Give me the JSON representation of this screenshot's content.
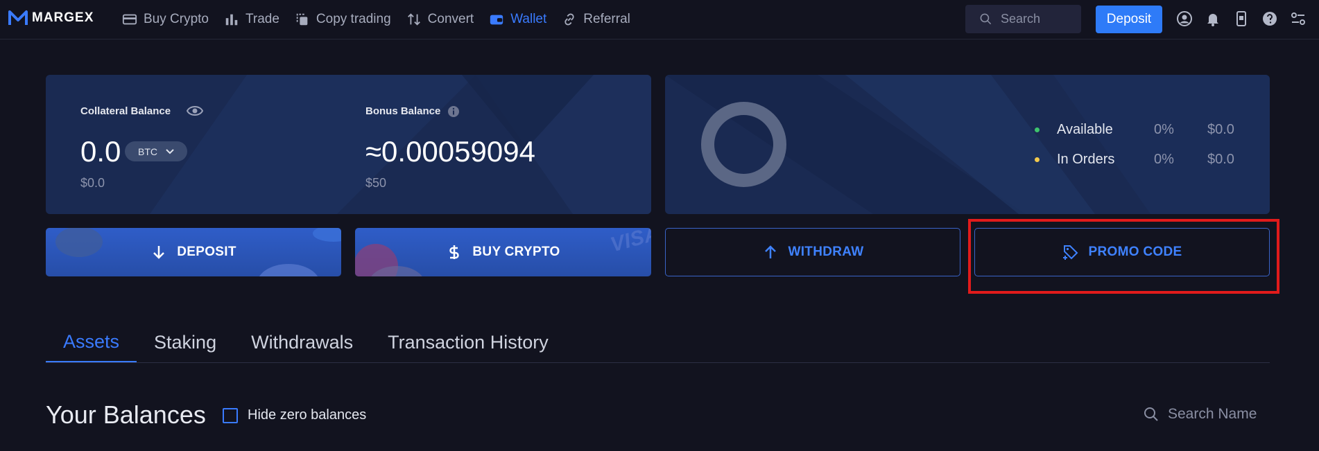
{
  "brand": {
    "name": "MARGEX"
  },
  "nav": {
    "items": [
      {
        "label": "Buy Crypto",
        "icon": "card-icon"
      },
      {
        "label": "Trade",
        "icon": "bar-chart-icon"
      },
      {
        "label": "Copy trading",
        "icon": "copy-icon"
      },
      {
        "label": "Convert",
        "icon": "swap-icon"
      },
      {
        "label": "Wallet",
        "icon": "wallet-icon",
        "active": true
      },
      {
        "label": "Referral",
        "icon": "link-icon"
      }
    ],
    "search_placeholder": "Search",
    "deposit_label": "Deposit",
    "icons": [
      "user-icon",
      "bell-icon",
      "mobile-icon",
      "help-icon",
      "settings-icon"
    ]
  },
  "balances": {
    "collateral": {
      "label": "Collateral Balance",
      "value": "0.0",
      "currency": "BTC",
      "usd": "$0.0"
    },
    "bonus": {
      "label": "Bonus Balance",
      "value": "≈0.00059094",
      "usd": "$50"
    }
  },
  "allocation": {
    "rows": [
      {
        "label": "Available",
        "percent": "0%",
        "amount": "$0.0",
        "color": "#3ec46d"
      },
      {
        "label": "In Orders",
        "percent": "0%",
        "amount": "$0.0",
        "color": "#f2c94c"
      }
    ]
  },
  "actions": {
    "deposit": "DEPOSIT",
    "buy_crypto": "BUY CRYPTO",
    "withdraw": "WITHDRAW",
    "promo_code": "PROMO CODE"
  },
  "tabs": [
    "Assets",
    "Staking",
    "Withdrawals",
    "Transaction History"
  ],
  "section": {
    "title": "Your Balances",
    "hide_zero_label": "Hide zero balances",
    "search_placeholder": "Search Name"
  },
  "colors": {
    "background": "#12131f",
    "card": "#1a2a52",
    "accent": "#2e7bf8",
    "highlight": "#e11b1b"
  }
}
